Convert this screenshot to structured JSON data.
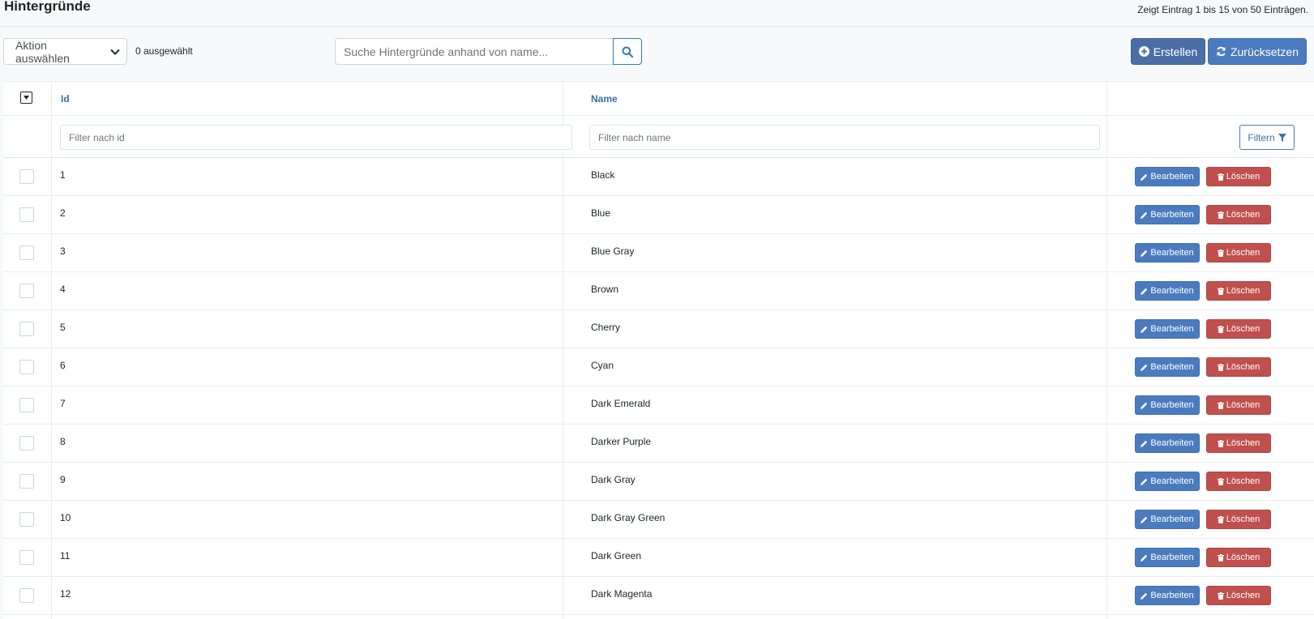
{
  "header": {
    "title": "Hintergründe",
    "summary": "Zeigt Eintrag 1 bis 15 von 50 Einträgen."
  },
  "toolbar": {
    "action_select": "Aktion auswählen",
    "selected_count": "0 ausgewählt",
    "search_placeholder": "Suche Hintergründe anhand von name...",
    "create_label": "Erstellen",
    "reset_label": "Zurücksetzen"
  },
  "table": {
    "columns": [
      "Id",
      "Name"
    ],
    "filter_id_placeholder": "Filter nach id",
    "filter_name_placeholder": "Filter nach name",
    "filter_button": "Filtern",
    "edit_label": "Bearbeiten",
    "delete_label": "Löschen",
    "rows": [
      {
        "id": "1",
        "name": "Black"
      },
      {
        "id": "2",
        "name": "Blue"
      },
      {
        "id": "3",
        "name": "Blue Gray"
      },
      {
        "id": "4",
        "name": "Brown"
      },
      {
        "id": "5",
        "name": "Cherry"
      },
      {
        "id": "6",
        "name": "Cyan"
      },
      {
        "id": "7",
        "name": "Dark Emerald"
      },
      {
        "id": "8",
        "name": "Darker Purple"
      },
      {
        "id": "9",
        "name": "Dark Gray"
      },
      {
        "id": "10",
        "name": "Dark Gray Green"
      },
      {
        "id": "11",
        "name": "Dark Green"
      },
      {
        "id": "12",
        "name": "Dark Magenta"
      }
    ]
  },
  "icons": {
    "search": "search-icon",
    "create": "plus-circle-icon",
    "reset": "refresh-icon",
    "filter": "funnel-icon",
    "edit": "pencil-icon",
    "delete": "trash-icon",
    "select_dropdown": "chevron-down-icon"
  },
  "colors": {
    "primary": "#4a7bbf",
    "create": "#4a6fa5",
    "danger": "#c0504d",
    "link": "#3a6ea5"
  }
}
